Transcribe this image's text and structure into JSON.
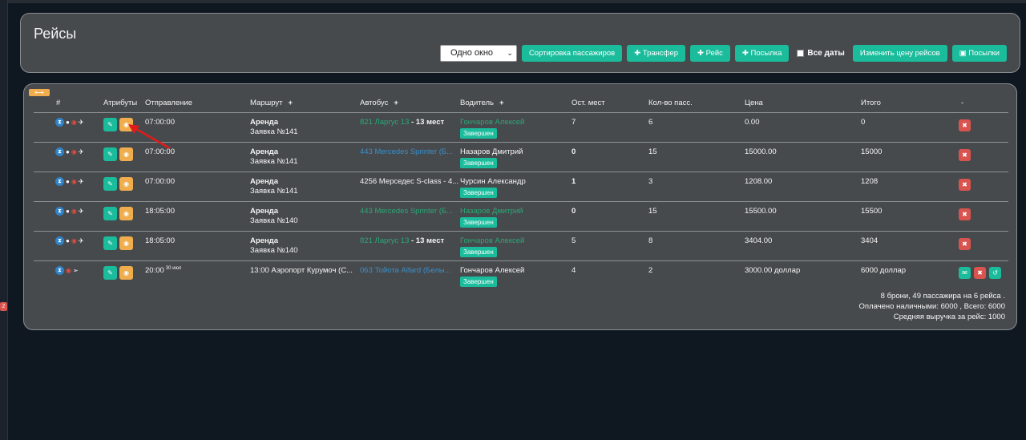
{
  "page": {
    "title": "Рейсы",
    "side_badge": "2"
  },
  "toolbar": {
    "window_select": "Одно окно",
    "sort_passengers": "Сортировка пассажиров",
    "transfer": "✚ Трансфер",
    "trip": "✚ Рейс",
    "parcel_add": "✚ Посылка",
    "all_dates": "Все даты",
    "change_price": "Изменить цену рейсов",
    "parcels": "Посылки"
  },
  "table": {
    "toggle": "⟷",
    "headers": {
      "num": "#",
      "attrs": "Атрибуты",
      "departure": "Отправление",
      "route": "Маршрут",
      "bus": "Автобус",
      "driver": "Водитель",
      "seats_left": "Ост. мест",
      "pass_count": "Кол-во пасс.",
      "price": "Цена",
      "total": "Итого",
      "dash": "-"
    },
    "rows": [
      {
        "time": "07:00:00",
        "time_sup": "",
        "route_main": "Аренда",
        "route_sub": "Заявка №141",
        "bus": "821 Ларгус 13",
        "bus_seats": " - 13 мест",
        "driver": "Гончаров Алексей",
        "status": "Завершен",
        "seats_left": "7",
        "pass": "6",
        "price": "0.00",
        "total": "0"
      },
      {
        "time": "07:00:00",
        "time_sup": "",
        "route_main": "Аренда",
        "route_sub": "Заявка №141",
        "bus": "443 Mercedes Sprinter (Б...",
        "bus_seats": "",
        "driver": "Назаров Дмитрий",
        "status": "Завершен",
        "seats_left": "0",
        "pass": "15",
        "price": "15000.00",
        "total": "15000"
      },
      {
        "time": "07:00:00",
        "time_sup": "",
        "route_main": "Аренда",
        "route_sub": "Заявка №141",
        "bus": "4256 Мерседес S-class - 4...",
        "bus_seats": "",
        "driver": "Чурсин Александр",
        "status": "Завершен",
        "seats_left": "1",
        "pass": "3",
        "price": "1208.00",
        "total": "1208"
      },
      {
        "time": "18:05:00",
        "time_sup": "",
        "route_main": "Аренда",
        "route_sub": "Заявка №140",
        "bus": "443 Mercedes Sprinter (Б...",
        "bus_seats": "",
        "driver": "Назаров Дмитрий",
        "status": "Завершен",
        "seats_left": "0",
        "pass": "15",
        "price": "15500.00",
        "total": "15500"
      },
      {
        "time": "18:05:00",
        "time_sup": "",
        "route_main": "Аренда",
        "route_sub": "Заявка №140",
        "bus": "821 Ларгус 13",
        "bus_seats": " - 13 мест",
        "driver": "Гончаров Алексей",
        "status": "Завершен",
        "seats_left": "5",
        "pass": "8",
        "price": "3404.00",
        "total": "3404"
      },
      {
        "time": "20:00",
        "time_sup": "30 июл",
        "route_main": "13:00 Аэропорт Курумоч (С...",
        "route_sub": "",
        "bus": "063 Тойота Alfard (Белы...",
        "bus_seats": "",
        "driver": "Гончаров Алексей",
        "status": "Завершен",
        "seats_left": "4",
        "pass": "2",
        "price": "3000.00 доллар",
        "total": "6000 доллар"
      }
    ]
  },
  "summary": {
    "line1": "8 брони, 49 пассажира на 6 рейса .",
    "line2": "Оплачено наличными: 6000 , Всего: 6000",
    "line3": "Средняя выручка за рейс: 1000"
  },
  "colors": {
    "panel_bg": "#474a4d",
    "page_bg": "#0f1720",
    "accent_teal": "#1abc9c",
    "accent_orange": "#f0ad4e",
    "danger_red": "#d9534f",
    "link_green": "#2aa876",
    "link_blue": "#3a8fc9"
  }
}
